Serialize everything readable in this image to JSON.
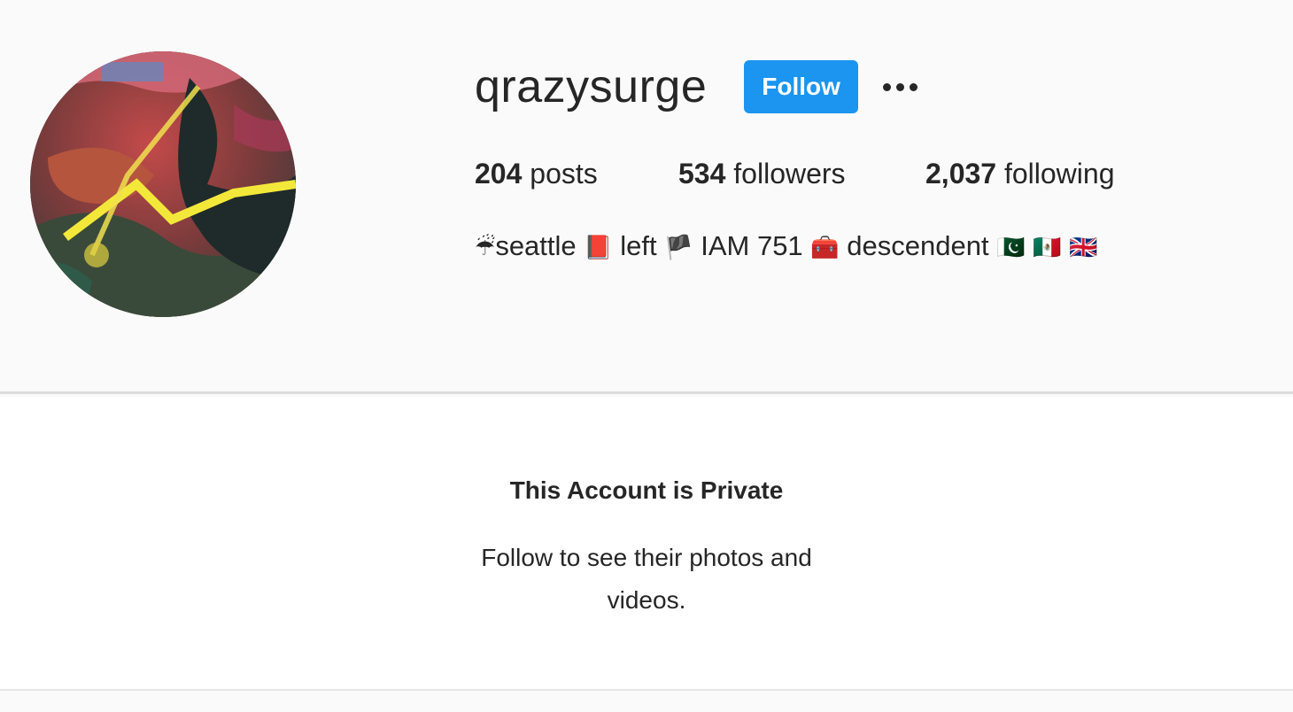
{
  "profile": {
    "username": "qrazysurge",
    "follow_label": "Follow",
    "more_label": "More options",
    "stats": {
      "posts_count": "204",
      "posts_label": " posts",
      "followers_count": "534",
      "followers_label": " followers",
      "following_count": "2,037",
      "following_label": " following"
    },
    "bio": {
      "umbrella": "☔",
      "seattle": "seattle ",
      "book": "📕",
      "left": " left ",
      "flag_black": "🏴",
      "iam": " IAM 751 ",
      "toolbox": "🧰",
      "descendent": " descendent ",
      "flag_pk": "🇵🇰",
      "flag_mx": "🇲🇽",
      "flag_gb": "🇬🇧"
    },
    "avatar_icon": "profile-avatar-artwork"
  },
  "private_notice": {
    "title": "This Account is Private",
    "message": "Follow to see their photos and videos."
  },
  "colors": {
    "accent": "#1b95f0",
    "text": "#262626",
    "background": "#fafafa"
  }
}
